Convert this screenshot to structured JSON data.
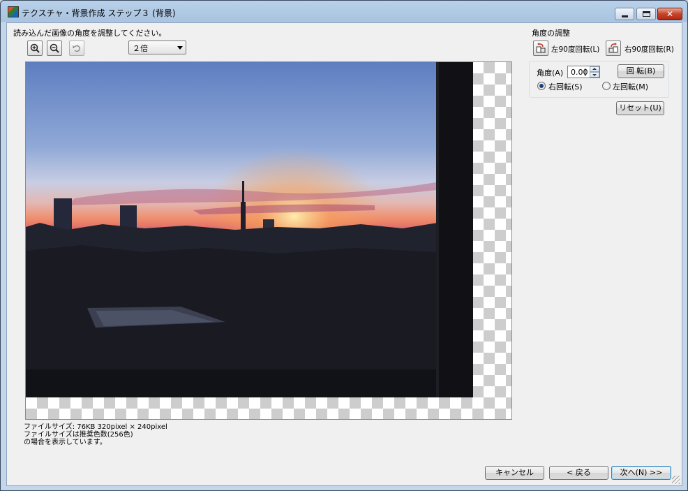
{
  "window": {
    "title": "テクスチャ・背景作成 ステップ３ (背景)"
  },
  "left": {
    "instruction": "読み込んだ画像の角度を調整してください。",
    "zoom_select_value": "２倍",
    "file_info_line1": "ファイルサイズ: 76KB 320pixel × 240pixel",
    "file_info_line2": "ファイルサイズは推奨色数(256色)",
    "file_info_line3": "の場合を表示しています。"
  },
  "right": {
    "title": "角度の調整",
    "rotate_left_90": "左90度回転(L)",
    "rotate_right_90": "右90度回転(R)",
    "angle_label": "角度(A)",
    "angle_value": "0.00",
    "rotate_button": "回 転(B)",
    "radio_cw": "右回転(S)",
    "radio_ccw": "左回転(M)",
    "radio_selected": "cw",
    "reset_button": "リセット(U)"
  },
  "footer": {
    "cancel": "キャンセル",
    "back": "< 戻る",
    "next": "次へ(N) >>"
  }
}
